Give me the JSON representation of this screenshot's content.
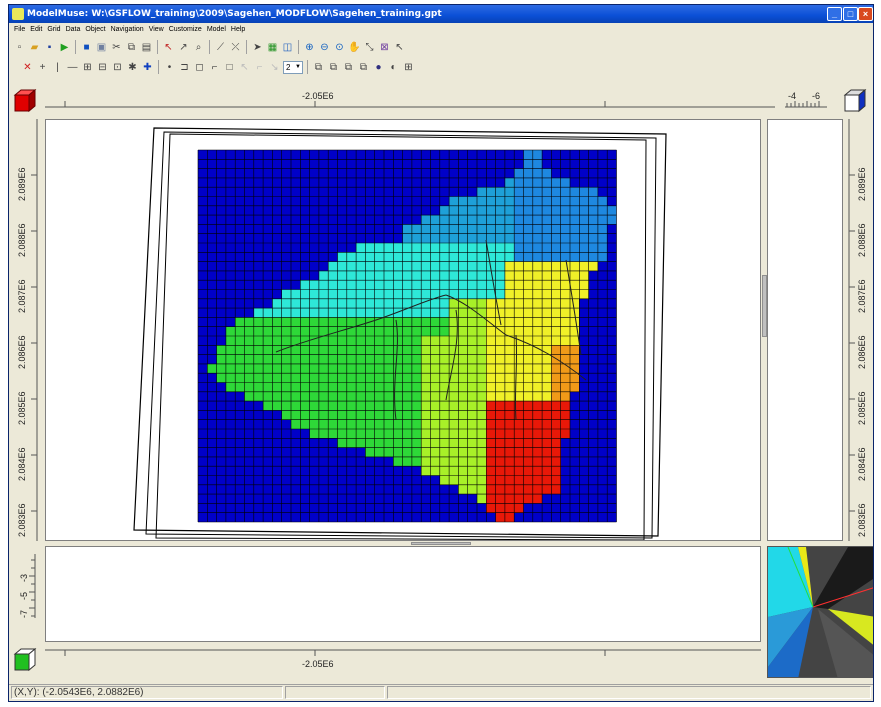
{
  "window": {
    "title": "ModelMuse: W:\\GSFLOW_training\\2009\\Sagehen_MODFLOW\\Sagehen_training.gpt"
  },
  "menu": [
    "File",
    "Edit",
    "Grid",
    "Data",
    "Object",
    "Navigation",
    "View",
    "Customize",
    "Model",
    "Help"
  ],
  "toolbar": {
    "layer_value": "2"
  },
  "top_ruler": {
    "x_label": "-2.05E6",
    "side_labels": [
      "-4",
      "-6"
    ]
  },
  "left_ruler": {
    "y_labels": [
      "2.089E6",
      "2.088E6",
      "2.087E6",
      "2.086E6",
      "2.085E6",
      "2.084E6",
      "2.083E6"
    ]
  },
  "right_ruler": {
    "y_labels": [
      "2.089E6",
      "2.088E6",
      "2.087E6",
      "2.086E6",
      "2.085E6",
      "2.084E6",
      "2.083E6"
    ]
  },
  "front_ruler": {
    "z_labels": [
      "-3",
      "-5",
      "-7"
    ]
  },
  "bottom_ruler": {
    "x_label": "-2.05E6"
  },
  "status": {
    "coords": "(X,Y): (-2.0543E6, 2.0882E6)"
  },
  "colors": {
    "inactive": "#0000c8",
    "zone_teal": "#1ea0d8",
    "zone_cyan": "#2ee8d8",
    "zone_green": "#2ed838",
    "zone_lime": "#a8f028",
    "zone_yellow": "#f0f028",
    "zone_orange": "#f09a18",
    "zone_red": "#e81808"
  },
  "icons": {
    "top_view_cube": "red-cube-icon",
    "side_view_cube": "blue-cube-icon",
    "front_view_cube": "green-cube-icon"
  }
}
